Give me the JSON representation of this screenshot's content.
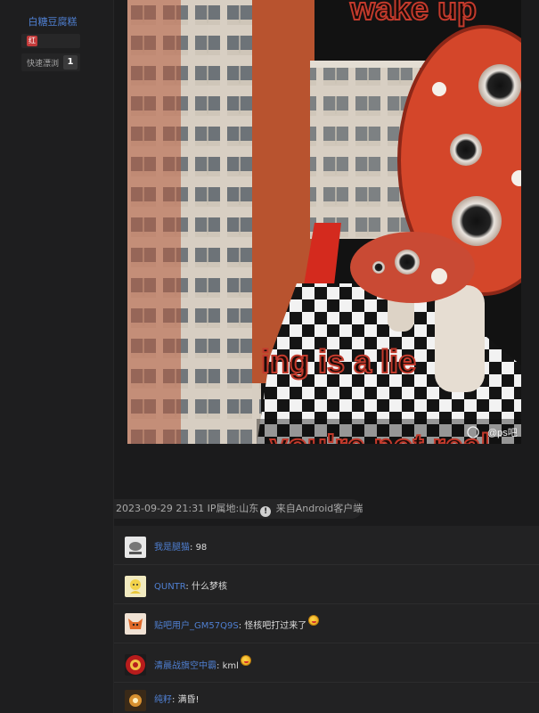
{
  "sidebar": {
    "username": "白糖豆腐糕",
    "badge_label": "红",
    "level_name": "快速漂浏",
    "level_number": "1"
  },
  "post": {
    "image_text_top": "wake up",
    "image_text_mid": "ing is a lie",
    "image_text_bottom": "you're not real",
    "watermark": "@ps吧",
    "meta": {
      "datetime": "2023-09-29 21:31",
      "ip_label": "IP属地:山东",
      "info_icon": "!",
      "client": "来自Android客户端"
    }
  },
  "comments": [
    {
      "user": "我是腿猫",
      "text": "98",
      "emoji": false,
      "avatar_color": "#e8e8e8"
    },
    {
      "user": "QUNTR",
      "text": "什么梦核",
      "emoji": false,
      "avatar_color": "#f1eac0"
    },
    {
      "user": "贴吧用户_GM57Q9S",
      "text": "怪核吧打过来了",
      "emoji": true,
      "avatar_color": "#f0e2d4"
    },
    {
      "user": "清晨战旗空中霸",
      "text": "kml",
      "emoji": true,
      "avatar_color": "#b71c1c"
    },
    {
      "user": "纯籽",
      "text": "满昏!",
      "emoji": false,
      "avatar_color": "#3a2a18"
    }
  ],
  "colors": {
    "link": "#4f7fd1",
    "background": "#1b1b1c",
    "mushroom": "#d4462a"
  }
}
